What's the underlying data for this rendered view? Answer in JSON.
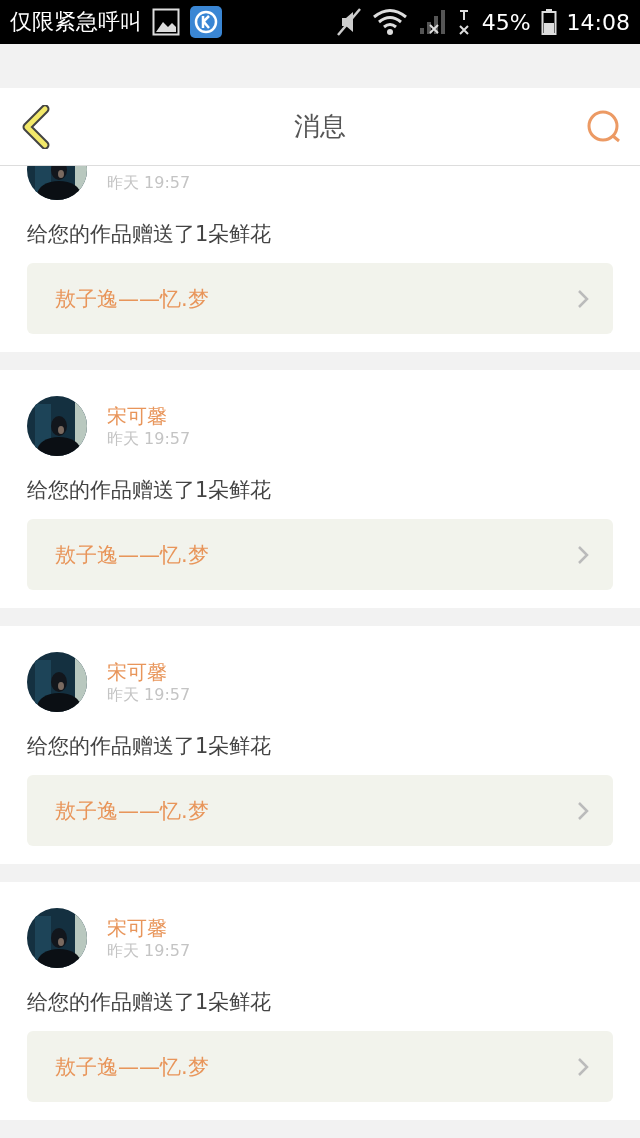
{
  "status_bar": {
    "carrier": "仅限紧急呼叫",
    "battery_text": "45%",
    "time": "14:08"
  },
  "header": {
    "title": "消息"
  },
  "messages": [
    {
      "time": "昨天 19:57",
      "text": "给您的作品赠送了1朵鲜花",
      "work": "敖子逸——忆.梦"
    },
    {
      "name": "宋可馨",
      "time": "昨天 19:57",
      "text": "给您的作品赠送了1朵鲜花",
      "work": "敖子逸——忆.梦"
    },
    {
      "name": "宋可馨",
      "time": "昨天 19:57",
      "text": "给您的作品赠送了1朵鲜花",
      "work": "敖子逸——忆.梦"
    },
    {
      "name": "宋可馨",
      "time": "昨天 19:57",
      "text": "给您的作品赠送了1朵鲜花",
      "work": "敖子逸——忆.梦"
    }
  ]
}
